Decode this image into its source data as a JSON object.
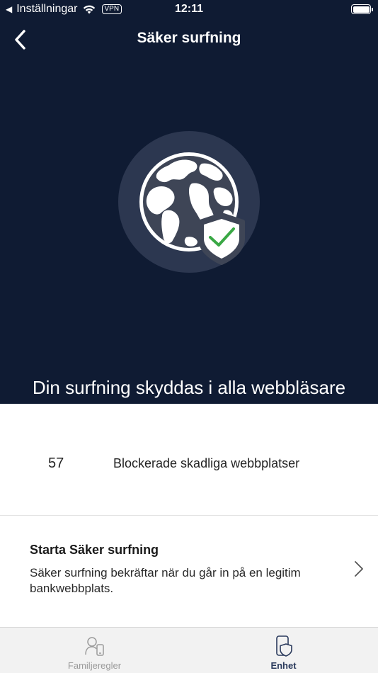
{
  "status_bar": {
    "back_app": "Inställningar",
    "vpn": "VPN",
    "time": "12:11"
  },
  "nav": {
    "title": "Säker surfning"
  },
  "hero": {
    "heading": "Din surfning skyddas i alla webbläsare"
  },
  "stats": {
    "count": "57",
    "label": "Blockerade skadliga webbplatser"
  },
  "start": {
    "title": "Starta Säker surfning",
    "description": "Säker surfning bekräftar när du går in på en legitim bankwebbplats."
  },
  "tabs": [
    {
      "label": "Familjeregler",
      "icon": "family-icon",
      "active": false
    },
    {
      "label": "Enhet",
      "icon": "device-shield-icon",
      "active": true
    }
  ],
  "colors": {
    "hero_bg": "#0f1b33",
    "ring": "#2c3750",
    "check": "#3aa845",
    "active_tab": "#2a3a5c"
  }
}
